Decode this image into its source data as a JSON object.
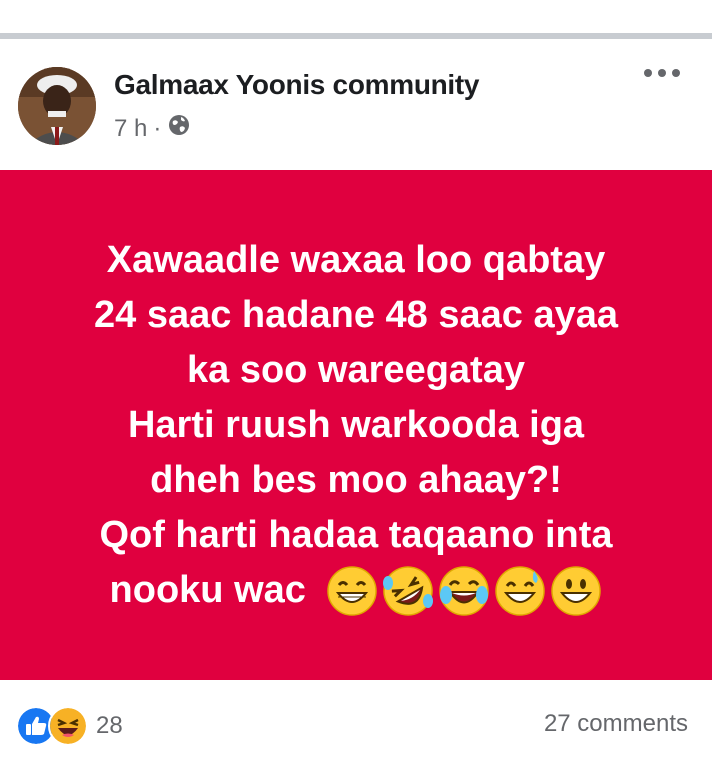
{
  "post": {
    "author": "Galmaax Yoonis community",
    "time": "7 h",
    "separator": "·",
    "privacy_icon": "globe-icon",
    "menu_icon": "more-options-icon",
    "background_color": "#e0003f",
    "lines": [
      "Xawaadle waxaa loo qabtay",
      "24 saac hadane 48 saac ayaa",
      "ka soo wareegatay",
      "Harti ruush warkooda iga",
      "dheh bes moo ahaay?!",
      "Qof harti hadaa taqaano inta"
    ],
    "last_line": "nooku wac",
    "emojis": [
      "grinning-face-with-smiling-eyes",
      "rolling-on-the-floor-laughing",
      "face-with-tears-of-joy",
      "grinning-face-with-sweat",
      "grinning-face"
    ]
  },
  "footer": {
    "reaction_icons": [
      "like-icon",
      "haha-icon"
    ],
    "reaction_count": "28",
    "comments": "27 comments"
  }
}
